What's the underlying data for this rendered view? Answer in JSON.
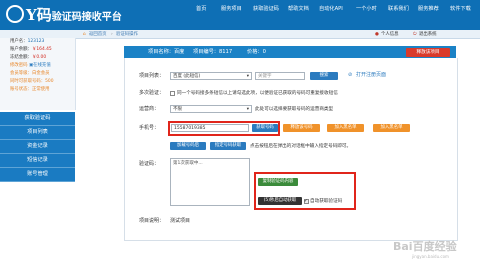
{
  "header": {
    "logo_text": "Y码",
    "site_title": "验证码接收平台",
    "nav": [
      "首页",
      "服务项目",
      "获取验证码",
      "帮助文档",
      "自动化API",
      "一个小时",
      "联系我们",
      "服务推荐",
      "软件下载"
    ]
  },
  "subheader": {
    "breadcrumb_home": "返回首页",
    "breadcrumb_current": "验证码操作",
    "user_info": "个人信息",
    "logout": "退出系统"
  },
  "account": {
    "username_label": "用户名：",
    "username": "123123",
    "balance_label": "账户余额：",
    "balance": "￥164.45",
    "frozen_label": "冻结金额：",
    "frozen": "￥0.00",
    "edit_password": "修改密码",
    "online_recharge": "在线充值",
    "level_label": "会员等级：",
    "level": "白金会员",
    "get_count_label": "同时可获取号码：",
    "get_count": "500",
    "status_label": "账号状态：",
    "status": "正常使用"
  },
  "sidebar": {
    "items": [
      "获取验证码",
      "项目列表",
      "资金记录",
      "短信记录",
      "账号管理"
    ]
  },
  "project_bar": {
    "name_label": "项目名称：",
    "name": "百度",
    "id_label": "项目编号：",
    "id": "8117",
    "price_label": "价格：",
    "price": "0",
    "release_button": "释放该项目"
  },
  "form": {
    "project_list_label": "项目列表：",
    "project_select": "百度 (此短信)",
    "keyword_placeholder": "关键字",
    "search_button": "搜索",
    "open_register_link": "打开注册页面",
    "multi_verify_label": "多次验证：",
    "multi_verify_text": "同一个号码接多条短信以上请勾选此项，以便验证已获取的号码可重复接收短信",
    "operator_label": "运营商：",
    "operator_value": "不限",
    "operator_note": "此处可以选择要获取号码的运营商类型",
    "phone_label": "手机号：",
    "phone_value": "15587019385",
    "get_number_button": "获取号码",
    "release_number_button": "释放该号码",
    "blacklist_button": "加入黑名单",
    "load_assigned_button": "加载号码后",
    "specify_number_button": "指定号码获取",
    "assign_note": "点击按钮后在弹出的对话框中输入指定号码即可。",
    "code_label": "验证码：",
    "code_value": "第1次获取中...",
    "copy_code_button": "复制验证码内容",
    "auto_fetch_button": "(5)秒后自动获取",
    "auto_fetch_checkbox": "自动获取验证码",
    "project_desc_label": "项目说明：",
    "project_desc": "测试项目"
  },
  "watermark": {
    "text": "Bai百度经验",
    "url": "jingyan.baidu.com"
  },
  "colors": {
    "header_bg": "#0e6fb5",
    "accent_blue": "#2b7bbf",
    "accent_orange": "#f0922a",
    "accent_green": "#3b8b3b",
    "highlight_red": "#e0251b"
  }
}
